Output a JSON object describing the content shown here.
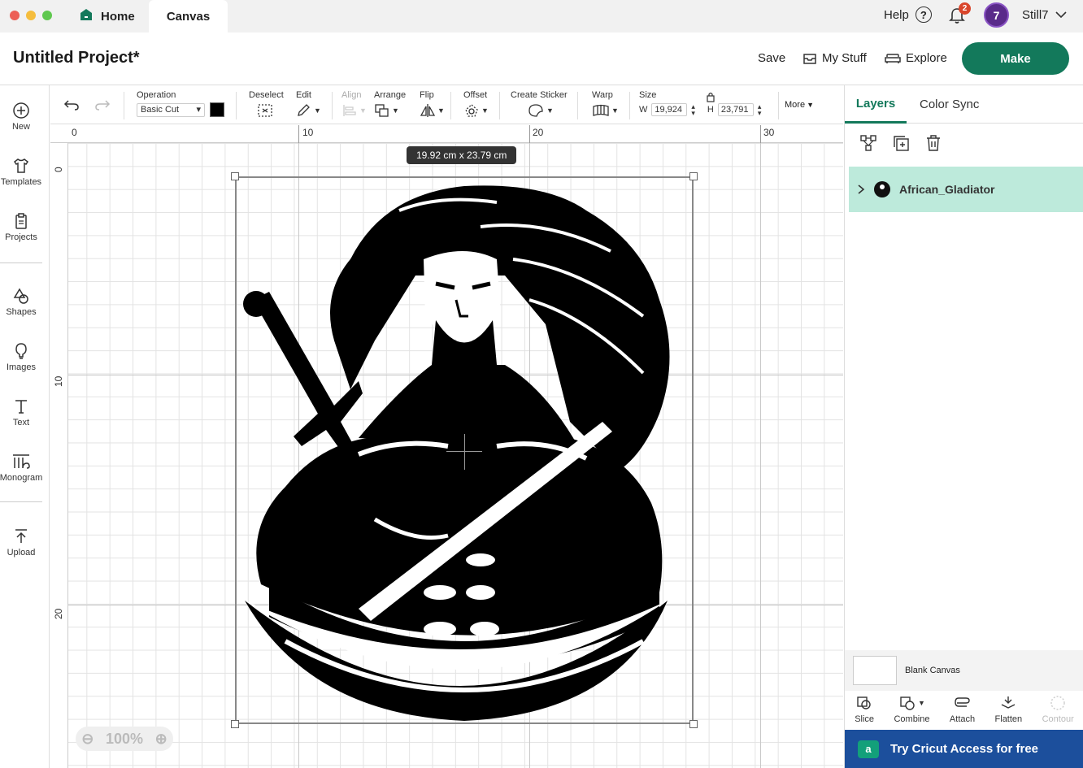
{
  "titlebar": {
    "tabs": [
      {
        "label": "Home"
      },
      {
        "label": "Canvas"
      }
    ],
    "help_label": "Help",
    "notification_count": "2",
    "avatar_text": "7",
    "username": "Still7"
  },
  "header": {
    "project_title": "Untitled Project*",
    "save_label": "Save",
    "mystuff_label": "My Stuff",
    "explore_label": "Explore",
    "make_label": "Make"
  },
  "leftnav": {
    "items": [
      {
        "label": "New",
        "icon": "plus-circle-icon"
      },
      {
        "label": "Templates",
        "icon": "shirt-icon"
      },
      {
        "label": "Projects",
        "icon": "clipboard-icon"
      },
      {
        "label": "Shapes",
        "icon": "shapes-icon"
      },
      {
        "label": "Images",
        "icon": "bulb-icon"
      },
      {
        "label": "Text",
        "icon": "text-icon"
      },
      {
        "label": "Monogram",
        "icon": "monogram-icon"
      },
      {
        "label": "Upload",
        "icon": "upload-icon"
      }
    ]
  },
  "toolbar": {
    "operation_label": "Operation",
    "operation_value": "Basic Cut",
    "deselect_label": "Deselect",
    "edit_label": "Edit",
    "align_label": "Align",
    "arrange_label": "Arrange",
    "flip_label": "Flip",
    "offset_label": "Offset",
    "create_sticker_label": "Create Sticker",
    "warp_label": "Warp",
    "size_label": "Size",
    "w_label": "W",
    "w_value": "19,924",
    "h_label": "H",
    "h_value": "23,791",
    "more_label": "More"
  },
  "canvas": {
    "ruler_top": [
      "0",
      "10",
      "20",
      "30"
    ],
    "ruler_left": [
      "0",
      "10",
      "20"
    ],
    "size_tooltip": "19.92  cm x 23.79  cm",
    "zoom_level": "100%"
  },
  "rightpanel": {
    "tab_layers": "Layers",
    "tab_colorsync": "Color Sync",
    "layer_name": "African_Gladiator",
    "blank_canvas_label": "Blank Canvas",
    "actions": [
      {
        "label": "Slice"
      },
      {
        "label": "Combine"
      },
      {
        "label": "Attach"
      },
      {
        "label": "Flatten"
      },
      {
        "label": "Contour"
      }
    ],
    "banner_text": "Try Cricut Access for free"
  },
  "colors": {
    "brand_green": "#13795b",
    "layer_highlight": "#bdeadb",
    "banner_blue": "#1c4f9c"
  }
}
